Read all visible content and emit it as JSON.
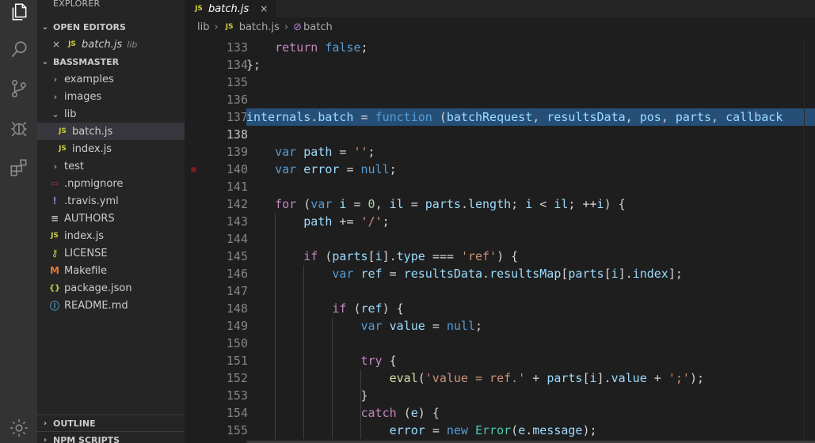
{
  "sidebar": {
    "title": "EXPLORER",
    "open_editors": {
      "header": "OPEN EDITORS",
      "items": [
        {
          "label": "batch.js",
          "dir": "lib",
          "icon": "JS"
        }
      ]
    },
    "project": {
      "header": "BASSMASTER",
      "items": [
        {
          "label": "examples",
          "icon": "",
          "chevron": "›"
        },
        {
          "label": "images",
          "icon": "",
          "chevron": "›"
        },
        {
          "label": "lib",
          "icon": "",
          "chevron": "⌄"
        },
        {
          "label": "batch.js",
          "icon": "JS"
        },
        {
          "label": "index.js",
          "icon": "JS"
        },
        {
          "label": "test",
          "icon": "",
          "chevron": "›"
        },
        {
          "label": ".npmignore",
          "icon": "▭"
        },
        {
          "label": ".travis.yml",
          "icon": "!"
        },
        {
          "label": "AUTHORS",
          "icon": "≡"
        },
        {
          "label": "index.js",
          "icon": "JS"
        },
        {
          "label": "LICENSE",
          "icon": "⚷"
        },
        {
          "label": "Makefile",
          "icon": "M"
        },
        {
          "label": "package.json",
          "icon": "{}"
        },
        {
          "label": "README.md",
          "icon": "ⓘ"
        }
      ]
    },
    "outline": "OUTLINE",
    "npm_scripts": "NPM SCRIPTS"
  },
  "tab": {
    "label": "batch.js",
    "icon": "JS",
    "close": "×"
  },
  "breadcrumb": {
    "folder": "lib",
    "file": "batch.js",
    "symbol": "batch",
    "file_icon": "JS",
    "symbol_icon": "⊘"
  },
  "code_lines": [
    {
      "n": "133",
      "text": "    return false;"
    },
    {
      "n": "134",
      "text": "};"
    },
    {
      "n": "135",
      "text": ""
    },
    {
      "n": "136",
      "text": ""
    },
    {
      "n": "137",
      "text": "internals.batch = function (batchRequest, resultsData, pos, parts, callback"
    },
    {
      "n": "138",
      "text": ""
    },
    {
      "n": "139",
      "text": "    var path = '';"
    },
    {
      "n": "140",
      "text": "    var error = null;"
    },
    {
      "n": "141",
      "text": ""
    },
    {
      "n": "142",
      "text": "    for (var i = 0, il = parts.length; i < il; ++i) {"
    },
    {
      "n": "143",
      "text": "        path += '/';"
    },
    {
      "n": "144",
      "text": ""
    },
    {
      "n": "145",
      "text": "        if (parts[i].type === 'ref') {"
    },
    {
      "n": "146",
      "text": "            var ref = resultsData.resultsMap[parts[i].index];"
    },
    {
      "n": "147",
      "text": ""
    },
    {
      "n": "148",
      "text": "            if (ref) {"
    },
    {
      "n": "149",
      "text": "                var value = null;"
    },
    {
      "n": "150",
      "text": ""
    },
    {
      "n": "151",
      "text": "                try {"
    },
    {
      "n": "152",
      "text": "                    eval('value = ref.' + parts[i].value + ';');"
    },
    {
      "n": "153",
      "text": "                }"
    },
    {
      "n": "154",
      "text": "                catch (e) {"
    },
    {
      "n": "155",
      "text": "                    error = new Error(e.message);"
    }
  ],
  "editor": {
    "highlighted_line": "137",
    "current_line": "138",
    "breakpoint_line": "140"
  }
}
